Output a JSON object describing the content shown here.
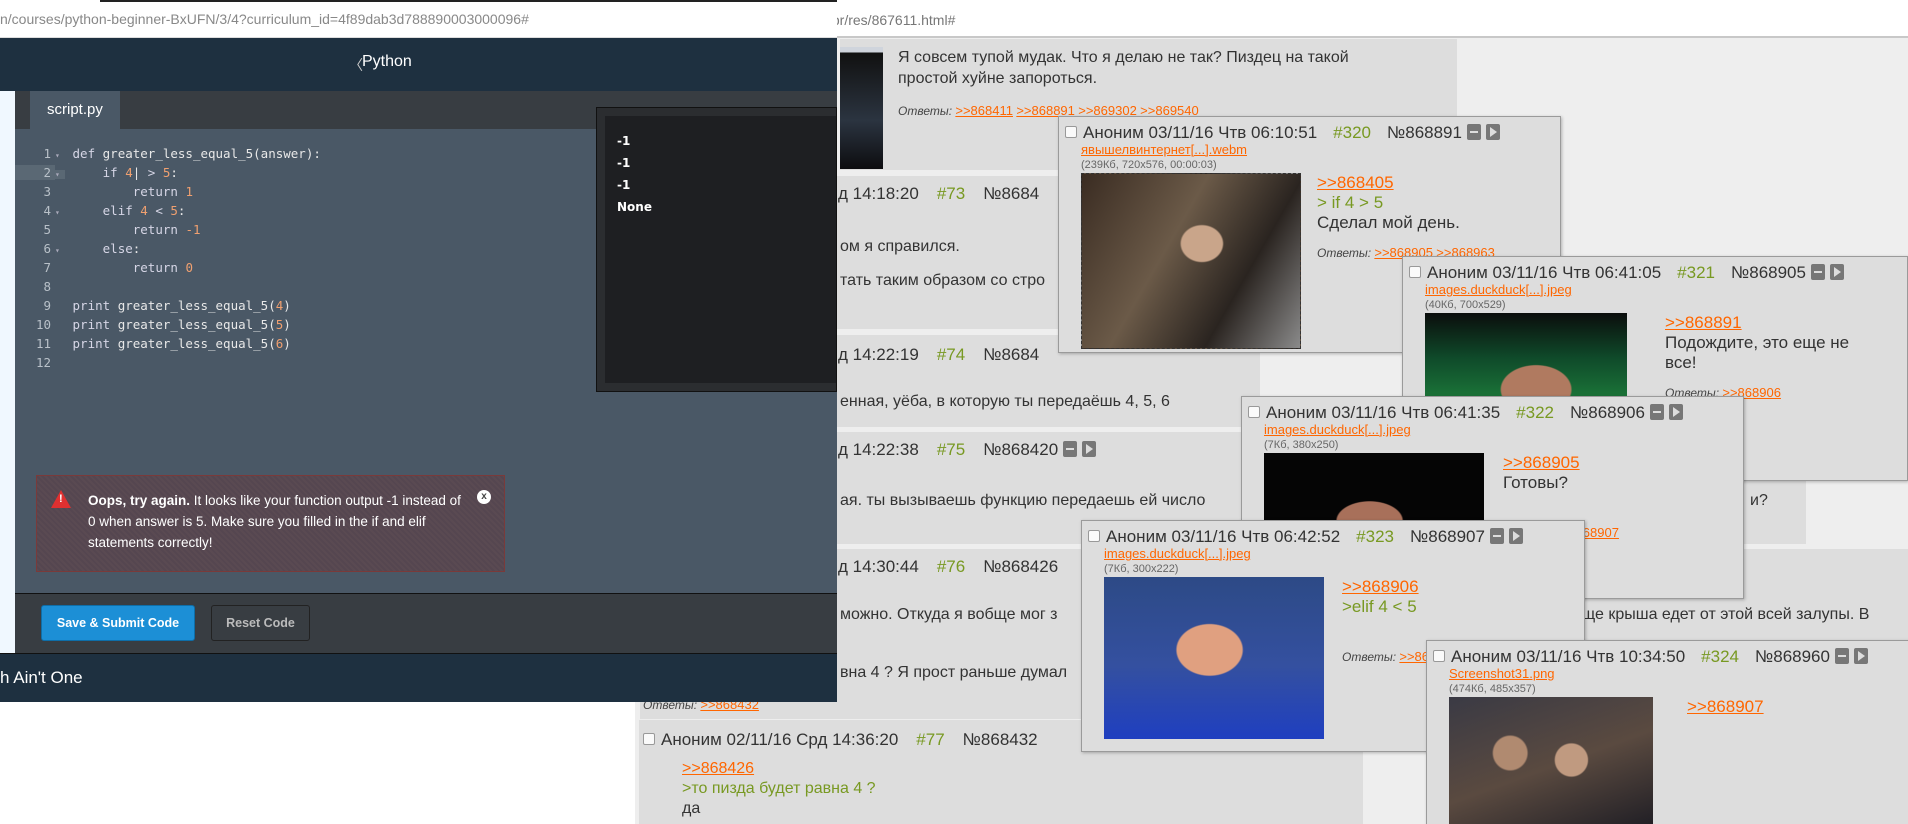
{
  "left_window": {
    "url": "n/courses/python-beginner-BxUFN/3/4?curriculum_id=4f89dab3d788890003000096#",
    "header": {
      "back_icon": "chevron-left-icon",
      "title": "Python"
    },
    "tab": "script.py",
    "code": [
      {
        "n": "1",
        "fold": true,
        "tokens": [
          [
            "kw",
            "def "
          ],
          [
            "",
            "greater_less_equal_5(answer):"
          ]
        ]
      },
      {
        "n": "2",
        "fold": true,
        "active": true,
        "tokens": [
          [
            "",
            "    "
          ],
          [
            "kw",
            "if "
          ],
          [
            "n",
            "4"
          ],
          [
            "",
            "|"
          ],
          [
            "kw",
            " > "
          ],
          [
            "n",
            "5"
          ],
          [
            "",
            ":"
          ]
        ]
      },
      {
        "n": "3",
        "tokens": [
          [
            "",
            "        "
          ],
          [
            "kw",
            "return "
          ],
          [
            "n",
            "1"
          ]
        ]
      },
      {
        "n": "4",
        "fold": true,
        "tokens": [
          [
            "",
            "    "
          ],
          [
            "kw",
            "elif "
          ],
          [
            "n",
            "4"
          ],
          [
            "kw",
            " < "
          ],
          [
            "n",
            "5"
          ],
          [
            "",
            ":"
          ]
        ]
      },
      {
        "n": "5",
        "tokens": [
          [
            "",
            "        "
          ],
          [
            "kw",
            "return "
          ],
          [
            "n",
            "-1"
          ]
        ]
      },
      {
        "n": "6",
        "fold": true,
        "tokens": [
          [
            "",
            "    "
          ],
          [
            "kw",
            "else"
          ],
          [
            "",
            ":"
          ]
        ]
      },
      {
        "n": "7",
        "tokens": [
          [
            "",
            "        "
          ],
          [
            "kw",
            "return "
          ],
          [
            "n",
            "0"
          ]
        ]
      },
      {
        "n": "8",
        "tokens": []
      },
      {
        "n": "9",
        "tokens": [
          [
            "kw",
            "print "
          ],
          [
            "",
            "greater_less_equal_5("
          ],
          [
            "n",
            "4"
          ],
          [
            "",
            ")"
          ]
        ]
      },
      {
        "n": "10",
        "tokens": [
          [
            "kw",
            "print "
          ],
          [
            "",
            "greater_less_equal_5("
          ],
          [
            "n",
            "5"
          ],
          [
            "",
            ")"
          ]
        ]
      },
      {
        "n": "11",
        "tokens": [
          [
            "kw",
            "print "
          ],
          [
            "",
            "greater_less_equal_5("
          ],
          [
            "n",
            "6"
          ],
          [
            "",
            ")"
          ]
        ]
      },
      {
        "n": "12",
        "tokens": []
      }
    ],
    "output": [
      "-1",
      "-1",
      "-1",
      "None"
    ],
    "error": {
      "icon": "warning-icon",
      "bold": "Oops, try again.",
      "text": " It looks like your function output -1 instead of 0 when answer is 5. Make sure you filled in the if and elif statements correctly!",
      "close_icon": "close-icon"
    },
    "buttons": {
      "submit": "Save & Submit Code",
      "reset": "Reset Code"
    },
    "footer_text": "h Ain't One"
  },
  "right_window": {
    "url": "/pr/res/867611.html#",
    "posts": {
      "p72": {
        "text1": "Я совсем тупой мудак. Что я делаю не так? Пиздец на такой",
        "text2": "простой хуйне запороться.",
        "answers_label": "Ответы:",
        "answers": [
          ">>868411",
          ">>868891",
          ">>869302",
          ">>869540"
        ]
      },
      "p73": {
        "time": "д 14:18:20",
        "num": "#73",
        "no": "№8684",
        "text1": "ом я справился.",
        "text2": "тать таким образом со стро"
      },
      "p74": {
        "time": "д 14:22:19",
        "num": "#74",
        "no": "№8684",
        "text1": "енная, уёба, в которую ты передаёшь 4, 5, 6"
      },
      "p75": {
        "time": "д 14:22:38",
        "num": "#75",
        "no": "№868420",
        "text1": "ая. ты вызываешь функцию передаешь ей число",
        "text2": "и?"
      },
      "p76": {
        "time": "д 14:30:44",
        "num": "#76",
        "no": "№868426",
        "text1": "можно. Откуда я вобще мог з",
        "text2": "ще крыша едет от этой всей залупы. В",
        "text3": "вна 4 ? Я прост раньше думал",
        "answers_label": "Ответы:",
        "answers": [
          ">>868432"
        ]
      },
      "p77": {
        "name": "Аноним",
        "date": "02/11/16 Срд 14:36:20",
        "num": "#77",
        "no": "№868432",
        "reply": ">>868426",
        "quote": ">то пизда будет равна 4 ?",
        "text": "да"
      }
    },
    "popups": [
      {
        "id": "320",
        "name": "Аноним",
        "date": "03/11/16 Чтв 06:10:51",
        "num": "#320",
        "no": "№868891",
        "file": "явышелвинтернет[...].webm",
        "info": "(239Кб, 720x576, 00:00:03)",
        "reply": ">>868405",
        "quotes": [
          "> if 4 > 5"
        ],
        "lines": [
          "Сделал мой день."
        ],
        "answers_label": "Ответы:",
        "answers": [
          ">>868905",
          ">>868963"
        ]
      },
      {
        "id": "321",
        "name": "Аноним",
        "date": "03/11/16 Чтв 06:41:05",
        "num": "#321",
        "no": "№868905",
        "file": "images.duckduck[...].jpeg",
        "info": "(40Кб, 700x529)",
        "reply": ">>868891",
        "quotes": [],
        "lines": [
          "Подождите, это еще не",
          "все!"
        ],
        "answers_label": "Ответы:",
        "answers": [
          ">>868906"
        ]
      },
      {
        "id": "322",
        "name": "Аноним",
        "date": "03/11/16 Чтв 06:41:35",
        "num": "#322",
        "no": "№868906",
        "file": "images.duckduck[...].jpeg",
        "info": "(7Кб, 380x250)",
        "reply": ">>868905",
        "quotes": [],
        "lines": [
          "Готовы?"
        ],
        "answers_label": "Ответы:",
        "answers": [
          ">>868907"
        ]
      },
      {
        "id": "323",
        "name": "Аноним",
        "date": "03/11/16 Чтв 06:42:52",
        "num": "#323",
        "no": "№868907",
        "file": "images.duckduck[...].jpeg",
        "info": "(7Кб, 300x222)",
        "reply": ">>868906",
        "quotes": [
          ">elif 4 < 5"
        ],
        "lines": [],
        "answers_label": "Ответы:",
        "answers": [
          ">>868960"
        ]
      },
      {
        "id": "324",
        "name": "Аноним",
        "date": "03/11/16 Чтв 10:34:50",
        "num": "#324",
        "no": "№868960",
        "file": "Screenshot31.png",
        "info": "(474Кб, 485x357)",
        "reply": ">>868907",
        "quotes": [],
        "lines": [],
        "answers_label": "",
        "answers": []
      }
    ],
    "colors": {
      "link": "#ff6600",
      "quote": "#789922",
      "post_bg": "#dddddd",
      "accent_button": "#1c8fd6"
    }
  }
}
